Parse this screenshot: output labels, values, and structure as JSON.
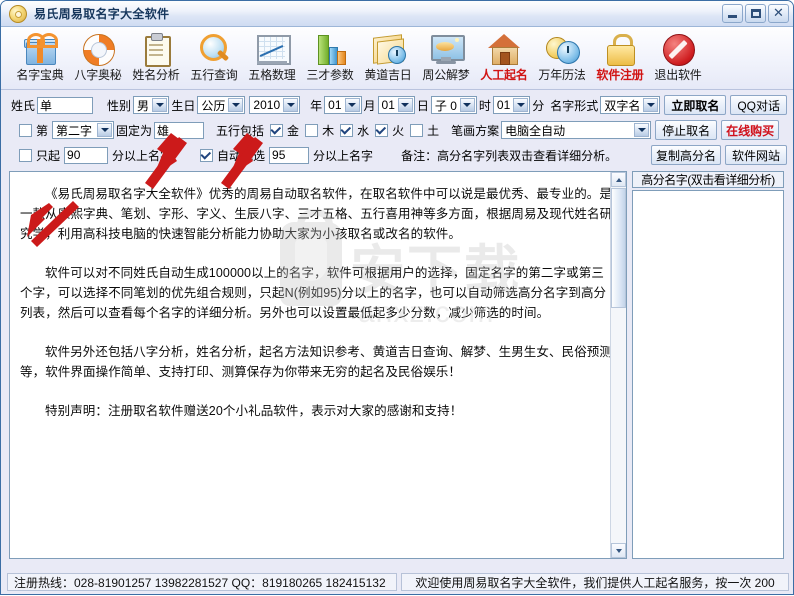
{
  "window": {
    "title": "易氏周易取名字大全软件",
    "title_icon": "disc-icon",
    "minimize_label": "",
    "maximize_label": "",
    "close_label": "✕"
  },
  "toolbar": {
    "items": [
      {
        "label": "名字宝典",
        "icon": "gift-icon",
        "red": false
      },
      {
        "label": "八字奥秘",
        "icon": "lifebuoy-icon",
        "red": false
      },
      {
        "label": "姓名分析",
        "icon": "clipboard-icon",
        "red": false
      },
      {
        "label": "五行查询",
        "icon": "magnifier-icon",
        "red": false
      },
      {
        "label": "五格数理",
        "icon": "line-chart-icon",
        "red": false
      },
      {
        "label": "三才参数",
        "icon": "bar-chart-icon",
        "red": false
      },
      {
        "label": "黄道吉日",
        "icon": "calendar-clock-icon",
        "red": false
      },
      {
        "label": "周公解梦",
        "icon": "monitor-dream-icon",
        "red": false
      },
      {
        "label": "人工起名",
        "icon": "house-icon",
        "red": true
      },
      {
        "label": "万年历法",
        "icon": "clocks-icon",
        "red": false
      },
      {
        "label": "软件注册",
        "icon": "lock-icon",
        "red": true
      },
      {
        "label": "退出软件",
        "icon": "stop-icon",
        "red": false
      }
    ]
  },
  "form": {
    "row1": {
      "surname_label": "姓氏",
      "surname_value": "单",
      "gender_label": "性别",
      "gender_value": "男",
      "birthday_label": "生日",
      "calendar_value": "公历",
      "year_value": "2010",
      "year_unit": "年",
      "month_value": "01",
      "month_unit": "月",
      "day_value": "01",
      "day_unit": "日",
      "hour_value": "子 0",
      "hour_unit": "时",
      "minute_value": "01",
      "minute_unit": "分",
      "nameform_label": "名字形式",
      "nameform_value": "双字名",
      "start_button": "立即取名",
      "qq_button": "QQ对话"
    },
    "row2": {
      "fix_checked": false,
      "fix_prefix": "第",
      "position_value": "第二字",
      "fix_mid": "固定为",
      "fix_char": "雄",
      "wuxing_label": "五行包括",
      "wuxing": [
        {
          "label": "金",
          "checked": true
        },
        {
          "label": "木",
          "checked": false
        },
        {
          "label": "水",
          "checked": true
        },
        {
          "label": "火",
          "checked": true
        },
        {
          "label": "土",
          "checked": false
        }
      ],
      "stroke_label": "笔画方案",
      "stroke_value": "电脑全自动",
      "stop_button": "停止取名",
      "buy_button": "在线购买"
    },
    "row3": {
      "only_checked": false,
      "only_prefix": "只起",
      "only_score": "90",
      "only_suffix": "分以上名字",
      "auto_checked": true,
      "auto_prefix": "自动挑选",
      "auto_score": "95",
      "auto_suffix": "分以上名字",
      "note": "备注：高分名字列表双击查看详细分析。",
      "copy_button": "复制高分名",
      "site_button": "软件网站"
    }
  },
  "main": {
    "paragraphs": [
      "《易氏周易取名字大全软件》优秀的周易自动取名软件，在取名软件中可以说是最优秀、最专业的。是一款从康熙字典、笔划、字形、字义、生辰八字、三才五格、五行喜用神等多方面，根据周易及现代姓名研究学，利用高科技电脑的快速智能分析能力协助大家为小孩取名或改名的软件。",
      "软件可以对不同姓氏自动生成100000以上的名字，软件可根据用户的选择，固定名字的第二字或第三个字，可以选择不同笔划的优先组合规则，只起N(例如95)分以上的名字，也可以自动筛选高分名字到高分列表，然后可以查看每个名字的详细分析。另外也可以设置最低起多少分数，减少筛选的时间。",
      "软件另外还包括八字分析，姓名分析，起名方法知识参考、黄道吉日查询、解梦、生男生女、民俗预测等，软件界面操作简单、支持打印、测算保存为你带来无穷的起名及民俗娱乐！",
      "特别声明：注册取名软件赠送20个小礼品软件，表示对大家的感谢和支持！"
    ],
    "watermark_big": "安下载",
    "watermark_small": "anxz.com"
  },
  "right_panel": {
    "header": "高分名字(双击看详细分析)",
    "items": []
  },
  "statusbar": {
    "left": "注册热线：028-81901257 13982281527 QQ：819180265 182415132",
    "right": "欢迎使用周易取名字大全软件，我们提供人工起名服务，按一次 200"
  },
  "colors": {
    "accent_red": "#d0111b",
    "title_blue": "#16365c",
    "panel_bg": "#e9eaf6",
    "annotation_arrow": "#cc1a1a"
  }
}
